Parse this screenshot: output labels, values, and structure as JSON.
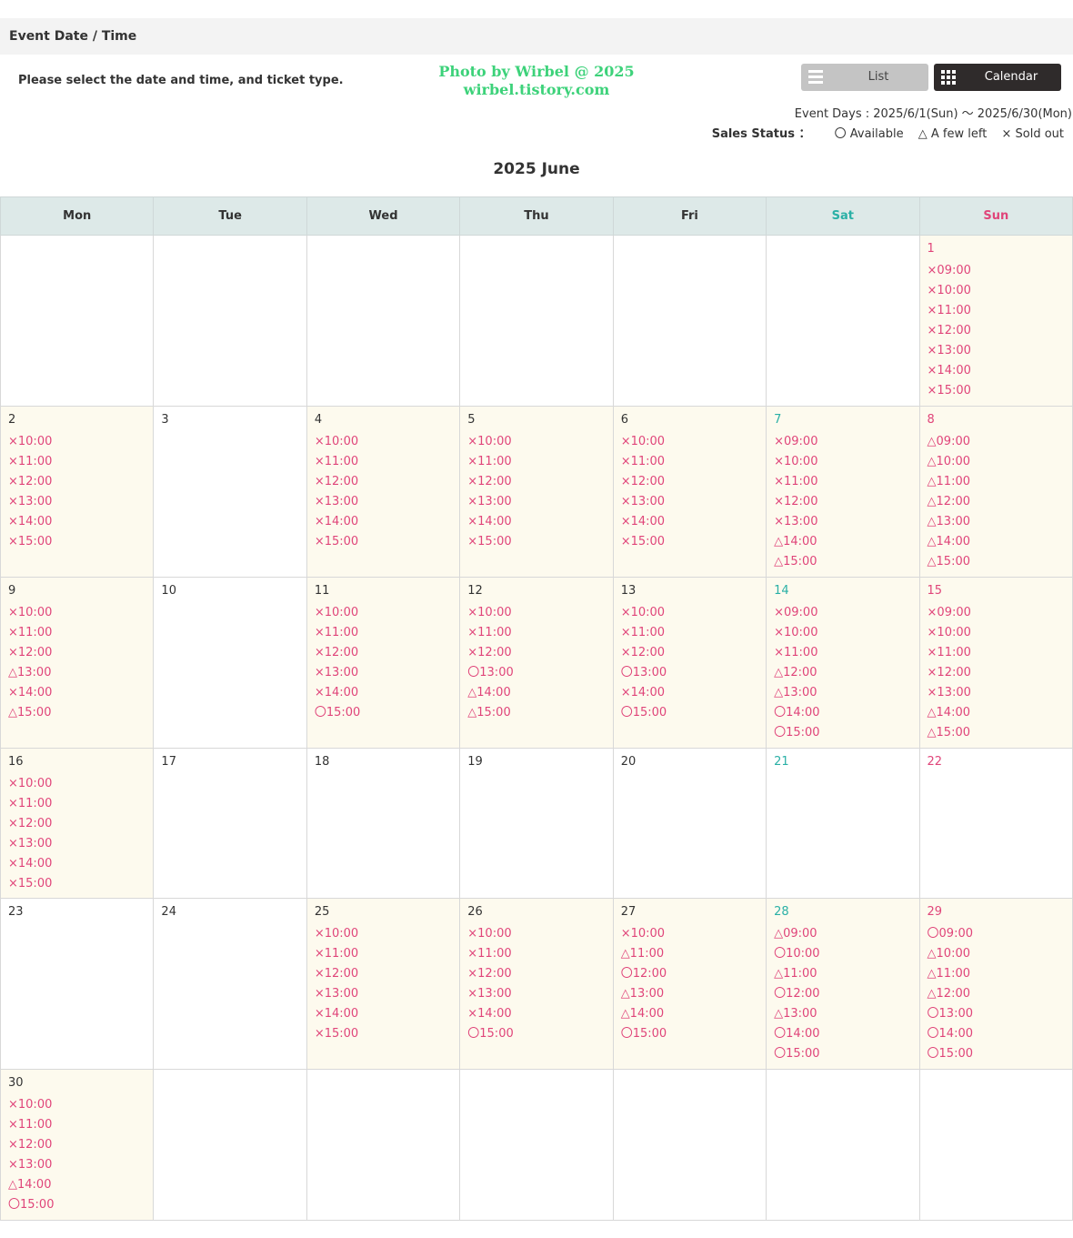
{
  "section": {
    "title": "Event Date / Time"
  },
  "instructions": "Please select the date and time, and ticket type.",
  "watermark": {
    "line1": "Photo by Wirbel @ 2025",
    "line2": "wirbel.tistory.com"
  },
  "view_toggle": {
    "list_label": "List",
    "calendar_label": "Calendar",
    "active": "Calendar"
  },
  "event_days": "Event Days : 2025/6/1(Sun) ～ 2025/6/30(Mon)",
  "sales_status": {
    "label": "Sales Status ：",
    "legend": [
      {
        "symbol": "〇",
        "text": "Available"
      },
      {
        "symbol": "△",
        "text": "A few left"
      },
      {
        "symbol": "×",
        "text": "Sold out"
      }
    ]
  },
  "month_title": "2025 June",
  "colors": {
    "sold_out": "#e0457a",
    "saturday": "#2ab0a6",
    "sunday": "#e0457a",
    "header_bg": "#dde9e8",
    "active_cell_bg": "#fdfaee"
  },
  "weekdays": [
    "Mon",
    "Tue",
    "Wed",
    "Thu",
    "Fri",
    "Sat",
    "Sun"
  ],
  "weeks": [
    [
      null,
      null,
      null,
      null,
      null,
      null,
      {
        "day": "1",
        "slots": [
          "×09:00",
          "×10:00",
          "×11:00",
          "×12:00",
          "×13:00",
          "×14:00",
          "×15:00"
        ]
      }
    ],
    [
      {
        "day": "2",
        "slots": [
          "×10:00",
          "×11:00",
          "×12:00",
          "×13:00",
          "×14:00",
          "×15:00"
        ]
      },
      {
        "day": "3",
        "slots": []
      },
      {
        "day": "4",
        "slots": [
          "×10:00",
          "×11:00",
          "×12:00",
          "×13:00",
          "×14:00",
          "×15:00"
        ]
      },
      {
        "day": "5",
        "slots": [
          "×10:00",
          "×11:00",
          "×12:00",
          "×13:00",
          "×14:00",
          "×15:00"
        ]
      },
      {
        "day": "6",
        "slots": [
          "×10:00",
          "×11:00",
          "×12:00",
          "×13:00",
          "×14:00",
          "×15:00"
        ]
      },
      {
        "day": "7",
        "slots": [
          "×09:00",
          "×10:00",
          "×11:00",
          "×12:00",
          "×13:00",
          "△14:00",
          "△15:00"
        ]
      },
      {
        "day": "8",
        "slots": [
          "△09:00",
          "△10:00",
          "△11:00",
          "△12:00",
          "△13:00",
          "△14:00",
          "△15:00"
        ]
      }
    ],
    [
      {
        "day": "9",
        "slots": [
          "×10:00",
          "×11:00",
          "×12:00",
          "△13:00",
          "×14:00",
          "△15:00"
        ]
      },
      {
        "day": "10",
        "slots": []
      },
      {
        "day": "11",
        "slots": [
          "×10:00",
          "×11:00",
          "×12:00",
          "×13:00",
          "×14:00",
          "〇15:00"
        ]
      },
      {
        "day": "12",
        "slots": [
          "×10:00",
          "×11:00",
          "×12:00",
          "〇13:00",
          "△14:00",
          "△15:00"
        ]
      },
      {
        "day": "13",
        "slots": [
          "×10:00",
          "×11:00",
          "×12:00",
          "〇13:00",
          "×14:00",
          "〇15:00"
        ]
      },
      {
        "day": "14",
        "slots": [
          "×09:00",
          "×10:00",
          "×11:00",
          "△12:00",
          "△13:00",
          "〇14:00",
          "〇15:00"
        ]
      },
      {
        "day": "15",
        "slots": [
          "×09:00",
          "×10:00",
          "×11:00",
          "×12:00",
          "×13:00",
          "△14:00",
          "△15:00"
        ]
      }
    ],
    [
      {
        "day": "16",
        "slots": [
          "×10:00",
          "×11:00",
          "×12:00",
          "×13:00",
          "×14:00",
          "×15:00"
        ]
      },
      {
        "day": "17",
        "slots": []
      },
      {
        "day": "18",
        "slots": []
      },
      {
        "day": "19",
        "slots": []
      },
      {
        "day": "20",
        "slots": []
      },
      {
        "day": "21",
        "slots": []
      },
      {
        "day": "22",
        "slots": []
      }
    ],
    [
      {
        "day": "23",
        "slots": []
      },
      {
        "day": "24",
        "slots": []
      },
      {
        "day": "25",
        "slots": [
          "×10:00",
          "×11:00",
          "×12:00",
          "×13:00",
          "×14:00",
          "×15:00"
        ]
      },
      {
        "day": "26",
        "slots": [
          "×10:00",
          "×11:00",
          "×12:00",
          "×13:00",
          "×14:00",
          "〇15:00"
        ]
      },
      {
        "day": "27",
        "slots": [
          "×10:00",
          "△11:00",
          "〇12:00",
          "△13:00",
          "△14:00",
          "〇15:00"
        ]
      },
      {
        "day": "28",
        "slots": [
          "△09:00",
          "〇10:00",
          "△11:00",
          "〇12:00",
          "△13:00",
          "〇14:00",
          "〇15:00"
        ]
      },
      {
        "day": "29",
        "slots": [
          "〇09:00",
          "△10:00",
          "△11:00",
          "△12:00",
          "〇13:00",
          "〇14:00",
          "〇15:00"
        ]
      }
    ],
    [
      {
        "day": "30",
        "slots": [
          "×10:00",
          "×11:00",
          "×12:00",
          "×13:00",
          "△14:00",
          "〇15:00"
        ]
      },
      null,
      null,
      null,
      null,
      null,
      null
    ]
  ]
}
